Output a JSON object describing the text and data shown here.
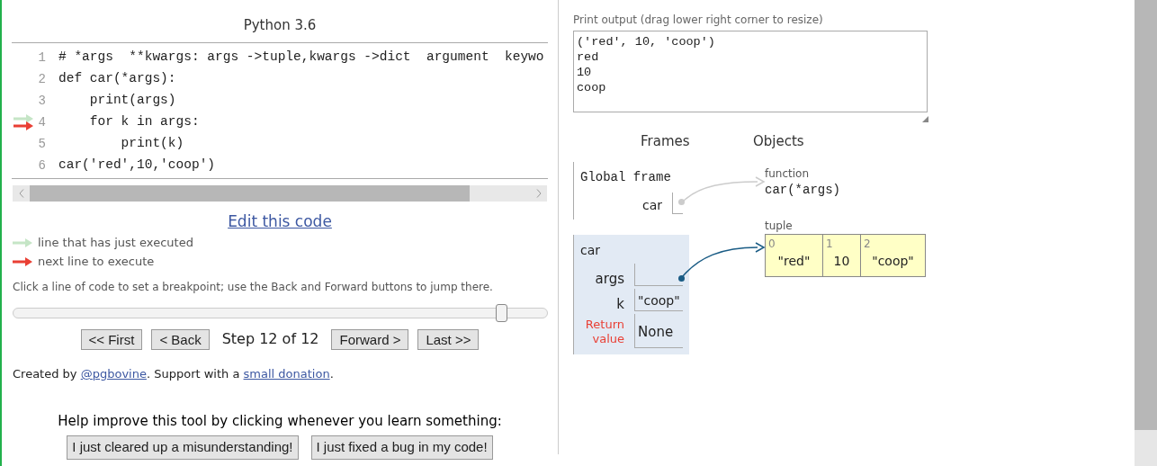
{
  "title": "Python 3.6",
  "code": {
    "lines": [
      {
        "number": "1",
        "text": "# *args  **kwargs: args ->tuple,kwargs ->dict  argument  keywo",
        "just_executed": false,
        "next": false
      },
      {
        "number": "2",
        "text": "def car(*args):",
        "just_executed": false,
        "next": false
      },
      {
        "number": "3",
        "text": "    print(args)",
        "just_executed": false,
        "next": false
      },
      {
        "number": "4",
        "text": "    for k in args:",
        "just_executed": true,
        "next": true
      },
      {
        "number": "5",
        "text": "        print(k)",
        "just_executed": false,
        "next": false
      },
      {
        "number": "6",
        "text": "car('red',10,'coop')",
        "just_executed": false,
        "next": false
      }
    ]
  },
  "edit_link": "Edit this code",
  "legend": [
    {
      "kind": "just_executed",
      "label": "line that has just executed"
    },
    {
      "kind": "next",
      "label": "next line to execute"
    }
  ],
  "hint": "Click a line of code to set a breakpoint; use the Back and Forward buttons to jump there.",
  "slider": {
    "level": 0.915
  },
  "nav": {
    "first": "<< First",
    "back": "< Back",
    "step": "Step 12 of 12",
    "forward": "Forward >",
    "last": "Last >>"
  },
  "credits": {
    "prefix": "Created by ",
    "author_link": "@pgbovine",
    "middle": ". Support with a ",
    "donation_link": "small donation",
    "suffix": "."
  },
  "help": {
    "text": "Help improve this tool by clicking whenever you learn something:",
    "buttons": [
      "I just cleared up a misunderstanding!",
      "I just fixed a bug in my code!"
    ]
  },
  "output": {
    "label": "Print output (drag lower right corner to resize)",
    "lines": [
      "('red', 10, 'coop')",
      "red",
      "10",
      "coop"
    ]
  },
  "viz": {
    "frames_heading": "Frames",
    "objects_heading": "Objects",
    "global_frame": {
      "title": "Global frame",
      "vars": [
        {
          "name": "car",
          "kind": "pointer"
        }
      ]
    },
    "stack_frames": [
      {
        "title": "car",
        "vars": [
          {
            "name": "args",
            "kind": "pointer"
          },
          {
            "name": "k",
            "kind": "value",
            "value": "\"coop\""
          }
        ],
        "return": {
          "label": "Return value",
          "value": "None"
        }
      }
    ],
    "objects": [
      {
        "kind": "function",
        "type_label": "function",
        "text": "car(*args)"
      },
      {
        "kind": "tuple",
        "type_label": "tuple",
        "items": [
          {
            "index": "0",
            "value": "\"red\""
          },
          {
            "index": "1",
            "value": "10"
          },
          {
            "index": "2",
            "value": "\"coop\""
          }
        ]
      }
    ]
  }
}
